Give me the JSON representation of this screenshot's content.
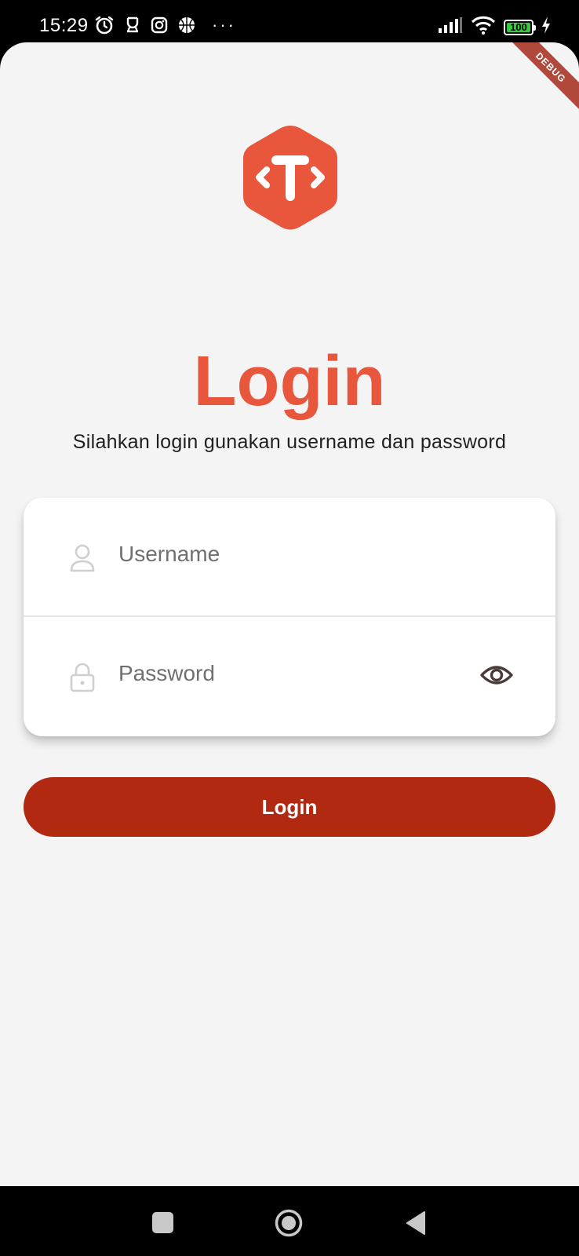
{
  "status_bar": {
    "time": "15:29",
    "battery_level": "100",
    "icons": [
      "alarm-icon",
      "notification-icon",
      "instagram-icon",
      "basketball-icon",
      "more-dots-icon",
      "signal-icon",
      "wifi-icon",
      "battery-icon",
      "charging-icon"
    ],
    "more": "···"
  },
  "debug_banner": "DEBUG",
  "header": {
    "title": "Login",
    "subtitle": "Silahkan login gunakan username dan password"
  },
  "form": {
    "username_placeholder": "Username",
    "password_placeholder": "Password"
  },
  "login_button": {
    "label": "Login"
  },
  "colors": {
    "accent": "#e8563b",
    "button": "#b22912",
    "background": "#f4f4f4"
  }
}
